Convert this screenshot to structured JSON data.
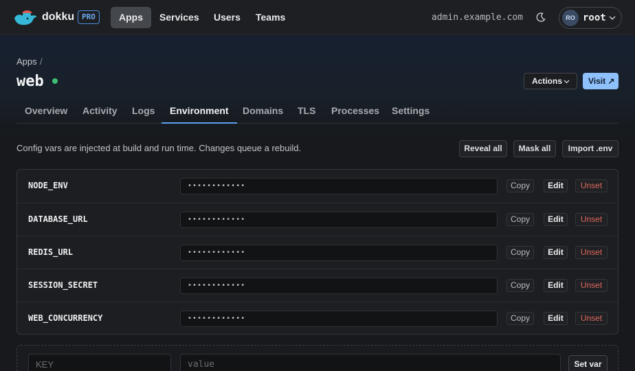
{
  "nav": {
    "brand": "dokku",
    "badge": "PRO",
    "links": [
      "Apps",
      "Services",
      "Users",
      "Teams"
    ],
    "active_link": "Apps",
    "host": "admin.example.com",
    "user": {
      "initials": "RO",
      "name": "root"
    }
  },
  "breadcrumb": {
    "root": "Apps",
    "separator": "/"
  },
  "app": {
    "name": "web",
    "status_color": "#3fbf73"
  },
  "header_actions": {
    "actions_label": "Actions",
    "visit_label": "Visit ↗"
  },
  "tabs": [
    "Overview",
    "Activity",
    "Logs",
    "Environment",
    "Domains",
    "TLS",
    "Processes",
    "Settings"
  ],
  "active_tab": "Environment",
  "environment": {
    "description": "Config vars are injected at build and run time. Changes queue a rebuild.",
    "toolbar": {
      "reveal_all": "Reveal all",
      "mask_all": "Mask all",
      "import_env": "Import .env"
    },
    "vars": [
      {
        "key": "NODE_ENV",
        "masked_value": "••••••••••••"
      },
      {
        "key": "DATABASE_URL",
        "masked_value": "••••••••••••"
      },
      {
        "key": "REDIS_URL",
        "masked_value": "••••••••••••"
      },
      {
        "key": "SESSION_SECRET",
        "masked_value": "••••••••••••"
      },
      {
        "key": "WEB_CONCURRENCY",
        "masked_value": "••••••••••••"
      }
    ],
    "row_actions": {
      "copy": "Copy",
      "edit": "Edit",
      "unset": "Unset"
    },
    "new_var": {
      "key_placeholder": "KEY",
      "value_placeholder": "value",
      "submit": "Set var"
    }
  },
  "colors": {
    "accent": "#8ec0fb",
    "danger": "#e0675d",
    "tab_underline": "#5da0ee"
  }
}
